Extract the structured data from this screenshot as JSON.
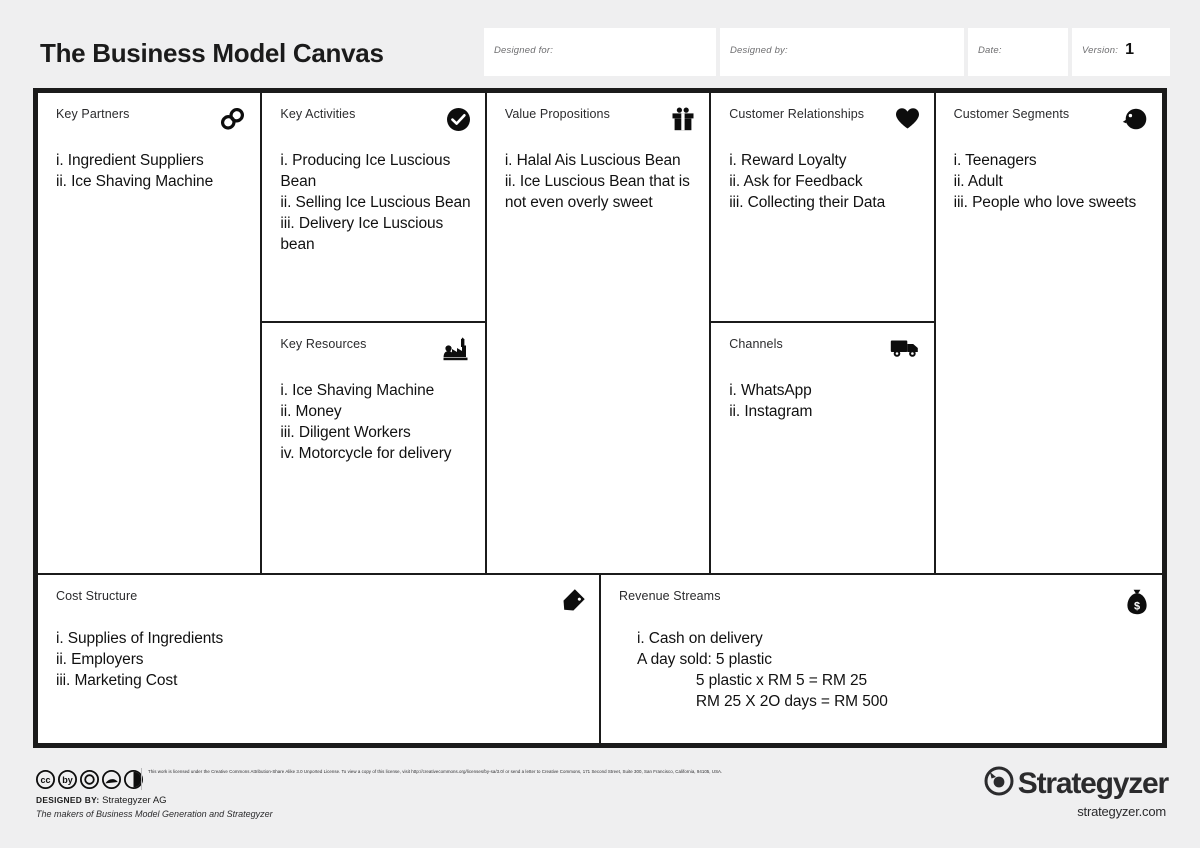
{
  "header": {
    "title": "The Business Model Canvas",
    "fields": [
      {
        "label": "Designed for:",
        "value": ""
      },
      {
        "label": "Designed by:",
        "value": ""
      },
      {
        "label": "Date:",
        "value": ""
      },
      {
        "label": "Version:",
        "value": "1"
      }
    ]
  },
  "blocks": {
    "key_partners": {
      "title": "Key Partners",
      "icon": "chain-link-icon",
      "body": "i. Ingredient Suppliers\nii. Ice Shaving Machine"
    },
    "key_activities": {
      "title": "Key Activities",
      "icon": "check-circle-icon",
      "body": "i. Producing Ice Luscious Bean\nii. Selling Ice Luscious Bean\niii. Delivery Ice Luscious bean"
    },
    "key_resources": {
      "title": "Key Resources",
      "icon": "factory-icon",
      "body": "i. Ice Shaving Machine\nii. Money\niii. Diligent Workers\niv. Motorcycle for delivery"
    },
    "value_propositions": {
      "title": "Value Propositions",
      "icon": "gift-icon",
      "body": "i. Halal Ais Luscious Bean\nii. Ice Luscious Bean that is not even overly sweet"
    },
    "customer_relationships": {
      "title": "Customer Relationships",
      "icon": "heart-icon",
      "body": "i. Reward Loyalty\nii. Ask for Feedback\niii. Collecting their Data"
    },
    "channels": {
      "title": "Channels",
      "icon": "delivery-truck-icon",
      "body": "i. WhatsApp\nii. Instagram"
    },
    "customer_segments": {
      "title": "Customer Segments",
      "icon": "person-head-icon",
      "body": "i. Teenagers\nii. Adult\niii. People who love sweets"
    },
    "cost_structure": {
      "title": "Cost Structure",
      "icon": "price-tag-icon",
      "body": "i. Supplies of Ingredients\nii. Employers\niii. Marketing Cost"
    },
    "revenue_streams": {
      "title": "Revenue Streams",
      "icon": "money-bag-icon",
      "body": "i. Cash on delivery\nA day sold: 5 plastic\n              5 plastic x RM 5 = RM 25\n              RM 25 X 2O days = RM 500"
    }
  },
  "footer": {
    "license_text": "This work is licensed under the Creative Commons Attribution-Share Alike 3.0 Unported License. To view a copy of this license, visit http://creativecommons.org/licenses/by-sa/3.0/ or send a letter to Creative Commons, 171 Second Street, Suite 300, San Francisco, California, 94105, USA.",
    "designed_by_label": "DESIGNED BY:",
    "designed_by_value": "Strategyzer AG",
    "makers": "The makers of Business Model Generation and Strategyzer",
    "brand_name": "Strategyzer",
    "brand_url": "strategyzer.com"
  }
}
